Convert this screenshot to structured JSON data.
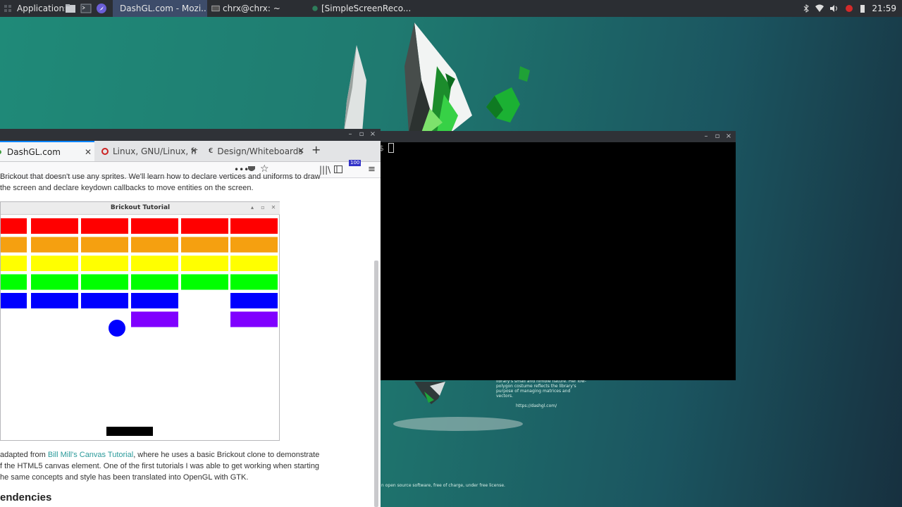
{
  "panel": {
    "apps_label": "Applications",
    "tasks": [
      {
        "label": "DashGL.com - Mozi...",
        "active": true
      },
      {
        "label": "chrx@chrx: ~",
        "active": false
      },
      {
        "label": "[SimpleScreenReco...",
        "active": false
      }
    ],
    "clock": "21:59"
  },
  "terminal": {
    "prompt": "$"
  },
  "firefox": {
    "tabs": [
      {
        "label": "DashGL.com"
      },
      {
        "label": "Linux, GNU/Linux, fr"
      },
      {
        "label": "Design/Whiteboards"
      }
    ],
    "badge": "100",
    "content": {
      "intro_line1": "Brickout that doesn't use any sprites. We'll learn how to declare vertices and uniforms to draw",
      "intro_line2": "the screen and declare keydown callbacks to move entities on the screen.",
      "para_line1_a": "adapted from ",
      "para_line1_link": "Bill Mill's Canvas Tutorial",
      "para_line1_b": ", where he uses a basic Brickout clone to demonstrate",
      "para_line2": "f the HTML5 canvas element. One of the first tutorials I was able to get working when starting",
      "para_line3": "he same concepts and style has been translated into OpenGL with GTK.",
      "heading": "endencies"
    }
  },
  "brickout": {
    "title": "Brickout Tutorial",
    "colors": {
      "red": "#ff0000",
      "orange": "#f5a010",
      "yellow": "#ffff00",
      "green": "#00ff00",
      "blue": "#0000ff",
      "purple": "#8000ff",
      "ball": "#0000ff",
      "paddle": "#000000"
    }
  },
  "wallpaper": {
    "text_lines": [
      "library's small and nimble nature. Her low-",
      "polygon costume reflects the library's",
      "purpose of managing matrices and",
      "vectors."
    ],
    "url": "https://dashgl.com/",
    "footer": "n open source software, free of charge, under free license."
  }
}
